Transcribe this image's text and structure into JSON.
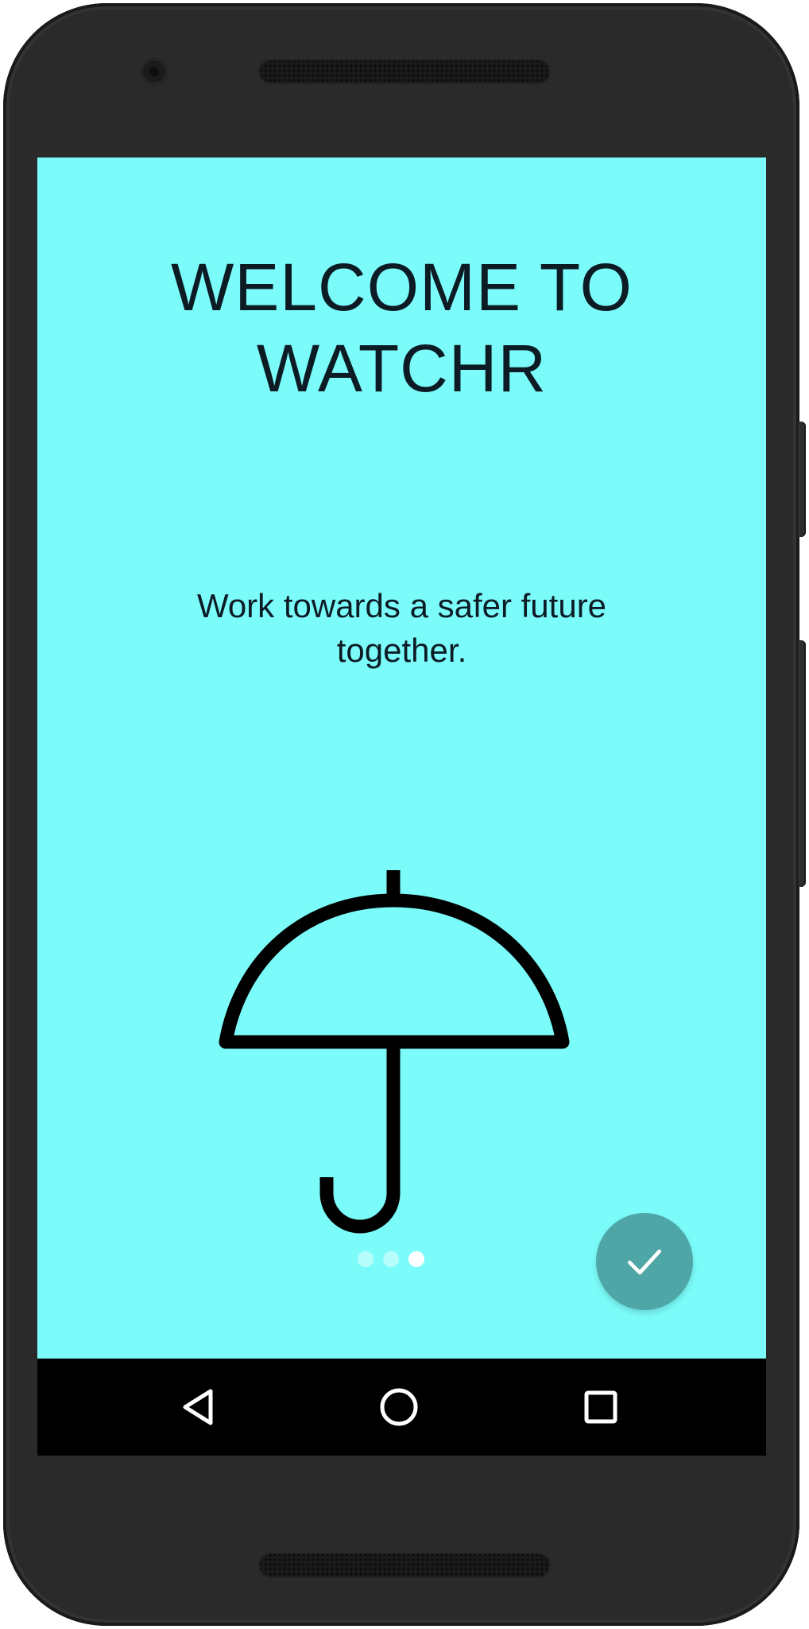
{
  "device": {
    "frame_color": "#2a2a2a"
  },
  "screen": {
    "background_color": "#7bfcfa",
    "title_lines": [
      "WELCOME TO",
      "WATCHR"
    ],
    "subtitle_lines": [
      "Work towards a safer future",
      "together."
    ],
    "illustration_icon": "umbrella-icon",
    "pager": {
      "total": 3,
      "active_index": 2
    },
    "fab": {
      "icon": "check-icon",
      "color": "#4fa6a6"
    }
  },
  "navbar": {
    "buttons": [
      "back-icon",
      "home-icon",
      "recents-icon"
    ]
  }
}
